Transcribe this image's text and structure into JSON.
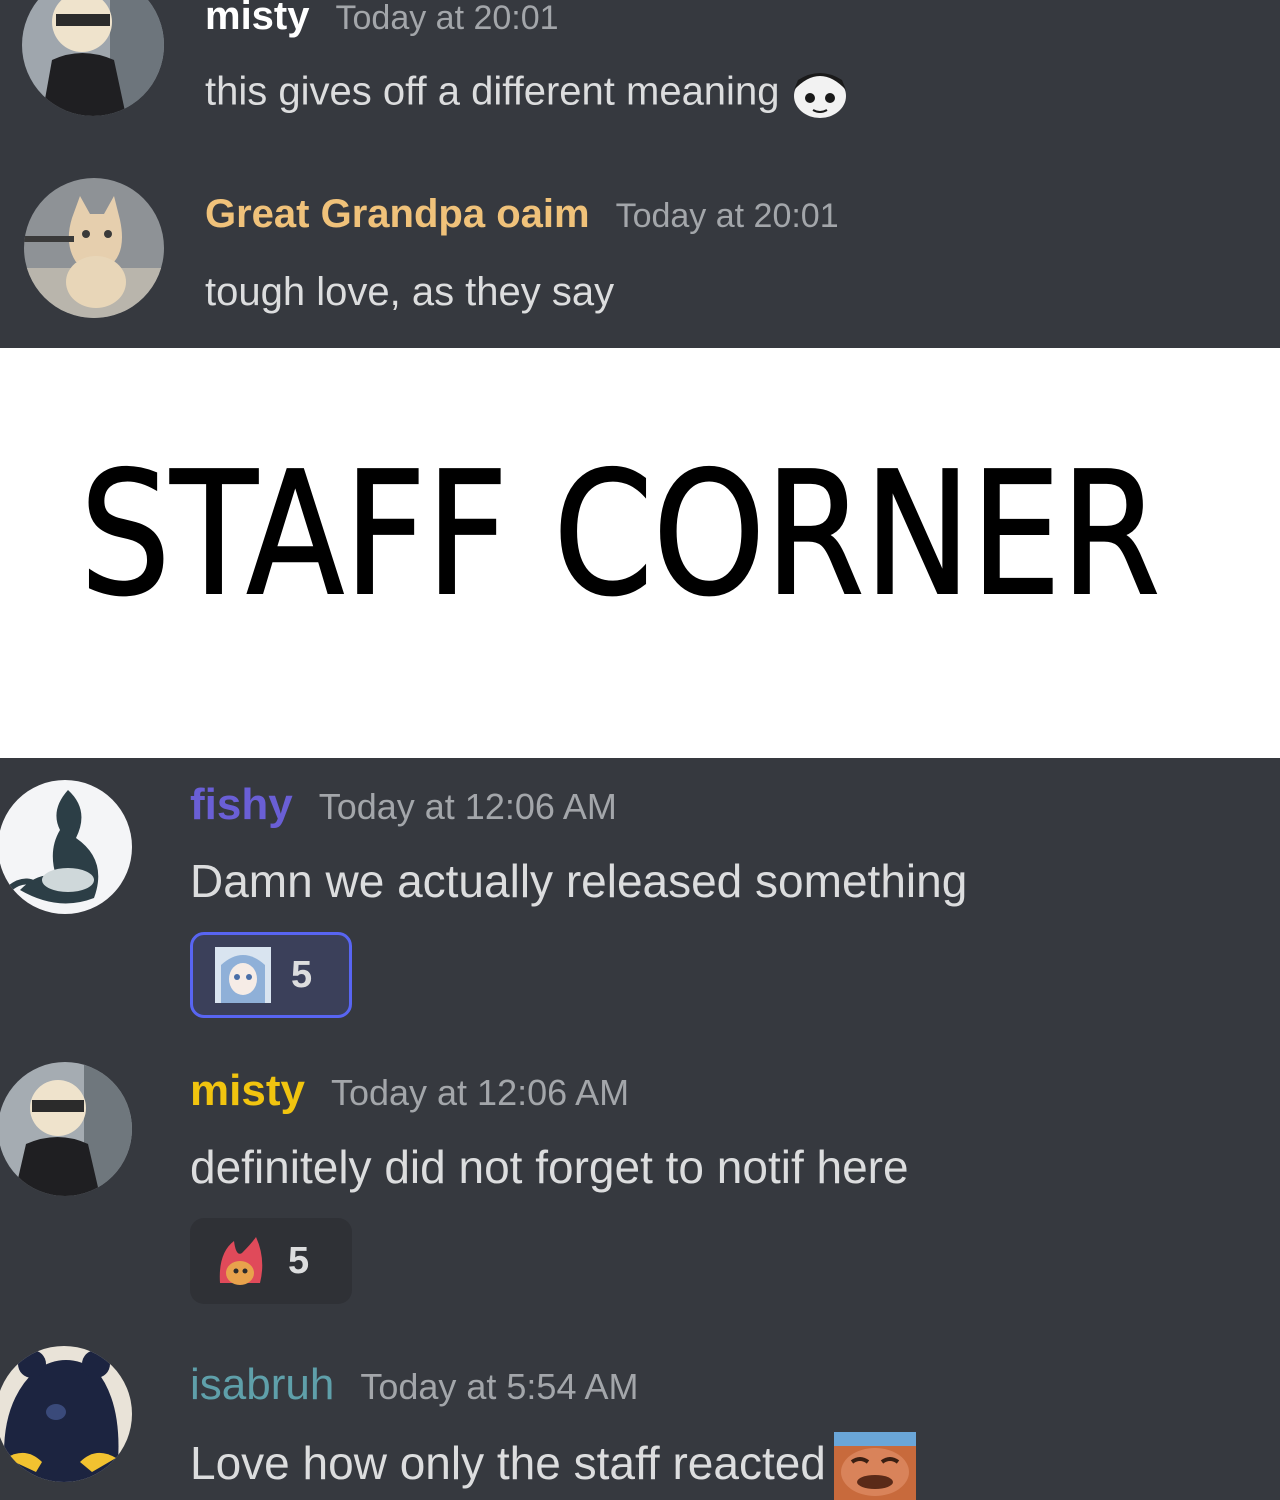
{
  "top_messages": [
    {
      "username": "misty",
      "timestamp": "Today at 20:01",
      "text": "this gives off a different meaning",
      "username_color": "#ffffff",
      "avatar": "anime-character-blindfold-avatar",
      "inline_emoji": "anime-face-emoji"
    },
    {
      "username": "Great Grandpa oaim",
      "timestamp": "Today at 20:01",
      "text": "tough love, as they say",
      "username_color": "#f0c27a",
      "avatar": "cat-avatar"
    }
  ],
  "divider": {
    "title": "STAFF CORNER",
    "background": "#ffffff",
    "text_color": "#000000"
  },
  "bottom_messages": [
    {
      "username": "fishy",
      "timestamp": "Today at 12:06 AM",
      "text": "Damn we actually released something",
      "username_color": "#6a5fd6",
      "avatar": "fish-creature-avatar",
      "reaction": {
        "emoji": "anime-girl-emoji",
        "count": "5",
        "active": true
      }
    },
    {
      "username": "misty",
      "timestamp": "Today at 12:06 AM",
      "text": "definitely did not forget to notif here",
      "username_color": "#f1c40f",
      "avatar": "anime-character-blindfold-avatar",
      "reaction": {
        "emoji": "fire-character-emoji",
        "count": "5",
        "active": false
      }
    },
    {
      "username": "isabruh",
      "timestamp": "Today at 5:54 AM",
      "text": "Love how only the staff reacted",
      "username_color": "#5fa0aa",
      "avatar": "dark-creature-avatar",
      "inline_emoji": "face-emoji"
    }
  ],
  "colors": {
    "chat_background": "#36393f",
    "message_text": "#dcddde",
    "timestamp": "#a3a6aa",
    "reaction_active_border": "#5865f2"
  }
}
